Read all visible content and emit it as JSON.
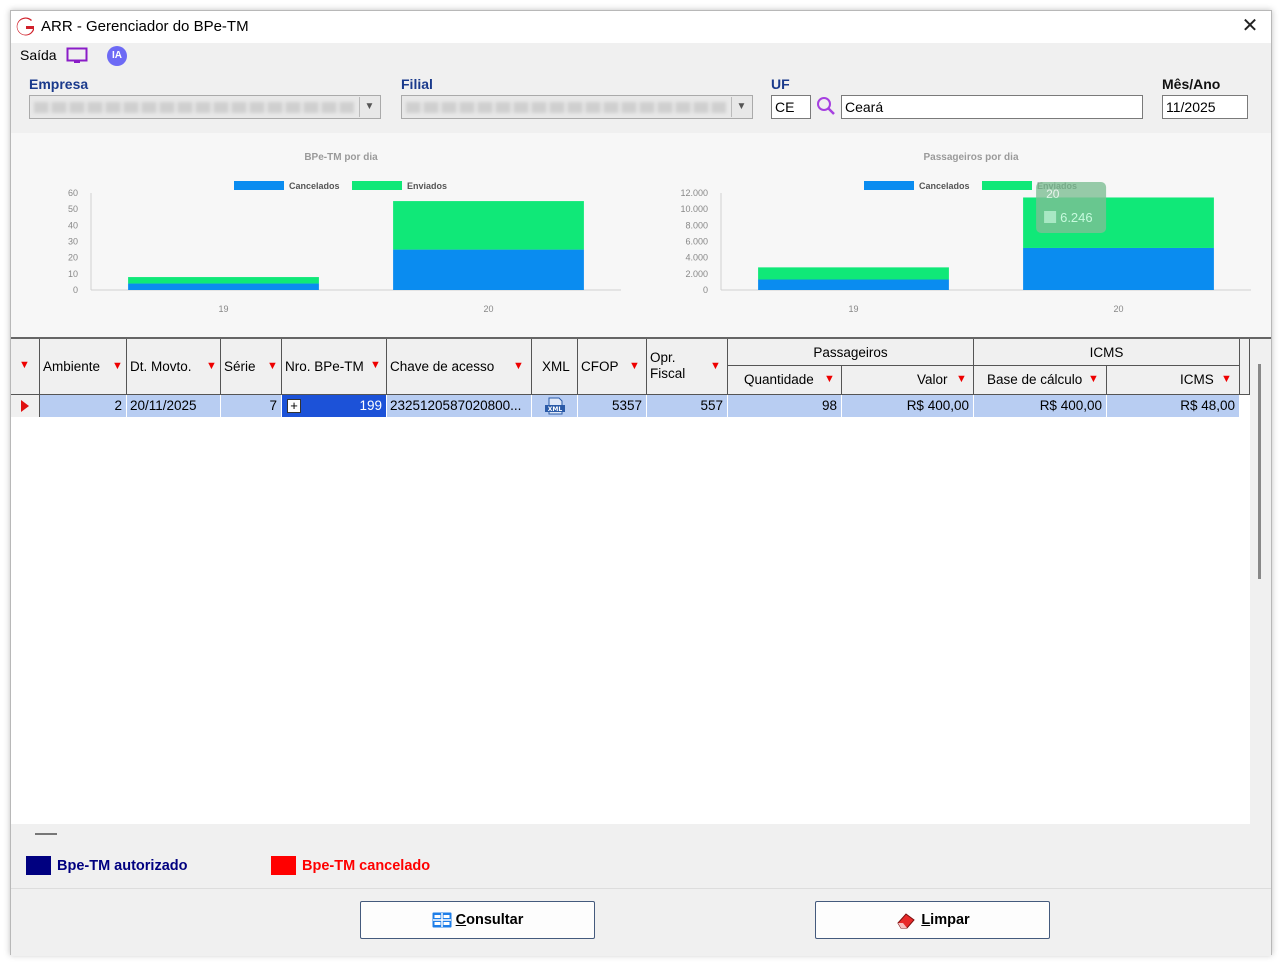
{
  "window": {
    "title": "ARR - Gerenciador do BPe-TM",
    "close": "✕"
  },
  "menu": {
    "saida": "Saída",
    "ia": "IA"
  },
  "filters": {
    "empresa_label": "Empresa",
    "filial_label": "Filial",
    "uf_label": "UF",
    "uf_code": "CE",
    "uf_name": "Ceará",
    "mes_ano_label": "Mês/Ano",
    "mes_ano": "11/2025"
  },
  "chart_data": [
    {
      "type": "bar",
      "title": "BPe-TM por dia",
      "categories": [
        "19",
        "20"
      ],
      "series": [
        {
          "name": "Cancelados",
          "values": [
            4,
            25
          ],
          "color": "#0a8cf0"
        },
        {
          "name": "Enviados",
          "values": [
            4,
            30
          ],
          "color": "#10e878"
        }
      ],
      "stacked": true,
      "ylim": [
        0,
        60
      ],
      "yticks": [
        "0",
        "10",
        "20",
        "30",
        "40",
        "50",
        "60"
      ],
      "legend": "top"
    },
    {
      "type": "bar",
      "title": "Passageiros por dia",
      "categories": [
        "19",
        "20"
      ],
      "series": [
        {
          "name": "Cancelados",
          "values": [
            1300,
            5200
          ],
          "color": "#0a8cf0"
        },
        {
          "name": "Enviados",
          "values": [
            1500,
            6246
          ],
          "color": "#10e878"
        }
      ],
      "stacked": true,
      "ylim": [
        0,
        12000
      ],
      "yticks": [
        "0",
        "2.000",
        "4.000",
        "6.000",
        "8.000",
        "10.000",
        "12.000"
      ],
      "legend": "top",
      "tooltip": {
        "category": "20",
        "value": "6.246"
      }
    }
  ],
  "grid": {
    "headers": {
      "ambiente": "Ambiente",
      "dt_movto": "Dt. Movto.",
      "serie": "Série",
      "nro": "Nro. BPe-TM",
      "chave": "Chave de acesso",
      "xml": "XML",
      "cfop": "CFOP",
      "opr_fiscal": "Opr.\nFiscal",
      "passageiros": "Passageiros",
      "quantidade": "Quantidade",
      "valor": "Valor",
      "icms_group": "ICMS",
      "base_calculo": "Base de cálculo",
      "icms": "ICMS"
    },
    "rows": [
      {
        "ambiente": "2",
        "dt_movto": "20/11/2025",
        "serie": "7",
        "nro": "199",
        "chave": "2325120587020800...",
        "xml_icon": "xml-file-icon",
        "cfop": "5357",
        "opr_fiscal": "557",
        "quantidade": "98",
        "valor": "R$ 400,00",
        "base_calculo": "R$ 400,00",
        "icms": "R$ 48,00"
      }
    ]
  },
  "legend": {
    "autorizado": "Bpe-TM autorizado",
    "autorizado_color": "#000080",
    "cancelado": "Bpe-TM cancelado",
    "cancelado_color": "#ff0000"
  },
  "buttons": {
    "consultar_first": "C",
    "consultar_rest": "onsultar",
    "limpar_first": "L",
    "limpar_rest": "impar"
  }
}
